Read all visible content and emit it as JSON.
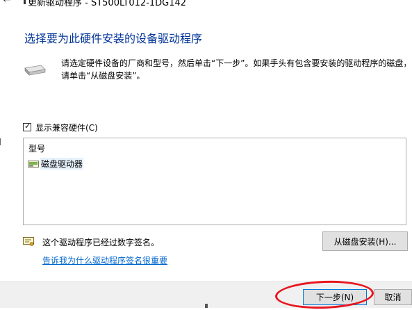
{
  "window": {
    "title": "更新驱动程序 - ST500LT012-1DG142"
  },
  "heading": "选择要为此硬件安装的设备驱动程序",
  "description": {
    "line1": "请选定硬件设备的厂商和型号，然后单击“下一步”。如果手头有包含要安装的驱动程序的磁盘，",
    "line2": "请单击“从磁盘安装”。"
  },
  "compatible_checkbox": {
    "label": "显示兼容硬件(C)",
    "checked": true
  },
  "model_list": {
    "header": "型号",
    "items": [
      {
        "label": "磁盘驱动器",
        "selected": true
      }
    ]
  },
  "signature": {
    "status": "这个驱动程序已经过数字签名。",
    "link": "告诉我为什么驱动程序签名很重要"
  },
  "buttons": {
    "have_disk": "从磁盘安装(H)...",
    "next": "下一步(N)",
    "cancel": "取消"
  },
  "colors": {
    "heading": "#003399",
    "link": "#0066cc",
    "annotation": "#e8141e",
    "footer_bg": "#f0f0f0",
    "selection": "#e5f1fb"
  }
}
